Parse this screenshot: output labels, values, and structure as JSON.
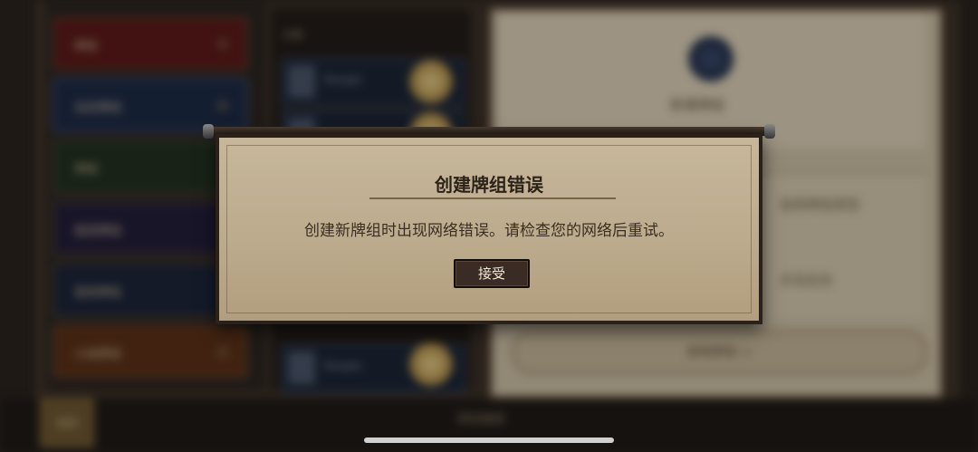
{
  "background": {
    "deck_tiles": [
      {
        "label": "牌组",
        "color": "#5a1a18"
      },
      {
        "label": "自定牌组",
        "color": "#1d2a44"
      },
      {
        "label": "预组",
        "color": "#223020"
      },
      {
        "label": "星辰牌组",
        "color": "#221e38"
      },
      {
        "label": "星辰牌组",
        "color": "#1c2438"
      },
      {
        "label": "火焰牌组",
        "color": "#5a3018"
      }
    ],
    "mid_header": "卡牌",
    "cards": [
      {
        "name": "Pinnath"
      },
      {
        "name": ""
      },
      {
        "name": "Pinnath"
      }
    ],
    "right_deck_name": "新建牌组",
    "right_text_1": "选择牌组类型",
    "right_text_2": "点击此处",
    "right_button": "复制牌组 +",
    "corner_button": "返回",
    "bottom_label": "牌组编辑"
  },
  "dialog": {
    "title": "创建牌组错误",
    "message": "创建新牌组时出现网络错误。请检查您的网络后重试。",
    "accept_label": "接受"
  }
}
